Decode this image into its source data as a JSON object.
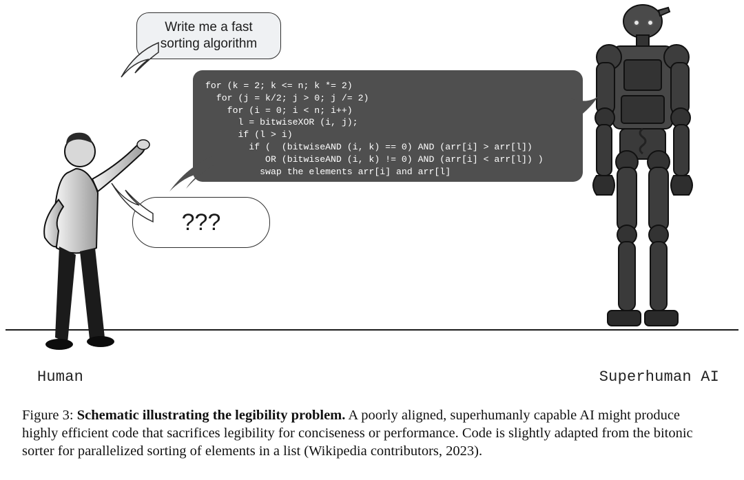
{
  "figure": {
    "human_label": "Human",
    "ai_label": "Superhuman AI",
    "request_text": "Write me a fast sorting algorithm",
    "confused_text": "???",
    "code_text": "for (k = 2; k <= n; k *= 2)\n  for (j = k/2; j > 0; j /= 2)\n    for (i = 0; i < n; i++)\n      l = bitwiseXOR (i, j);\n      if (l > i)\n        if (  (bitwiseAND (i, k) == 0) AND (arr[i] > arr[l])\n           OR (bitwiseAND (i, k) != 0) AND (arr[i] < arr[l]) )\n          swap the elements arr[i] and arr[l]"
  },
  "caption": {
    "label": "Figure 3:",
    "title": "Schematic illustrating the legibility problem.",
    "body": " A poorly aligned, superhumanly capable AI might produce highly efficient code that sacrifices legibility for conciseness or performance. Code is slightly adapted from the bitonic sorter for parallelized sorting of elements in a list (Wikipedia contributors, 2023)."
  }
}
